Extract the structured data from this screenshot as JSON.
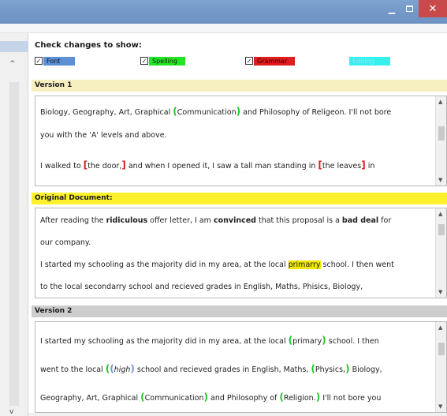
{
  "window": {
    "minimize_glyph": "▁",
    "close_glyph": "✕"
  },
  "check": {
    "title": "Check changes to show:",
    "checkmark": "✓",
    "font_label": "Font",
    "spelling_label": "Spelling",
    "grammar_label": "Grammar",
    "editing_label": "Editing"
  },
  "sections": {
    "version1": "Version 1",
    "original": "Original Document:",
    "version2": "Version 2"
  },
  "version1": {
    "l1_a": "Biology, Geography, Art, Graphical ",
    "l1_b": "Communication",
    "l1_c": " and Philosophy of Religeon. I'll not bore",
    "l2": "you with the 'A' levels and above.",
    "l3_a": "I walked to ",
    "l3_b": "the door,",
    "l3_c": " and when I opened it, I saw a tall man standing in ",
    "l3_d": "the leaves",
    "l3_e": " in"
  },
  "original": {
    "l1_a": "After reading the ",
    "l1_b": "ridiculous",
    "l1_c": " offer letter, I am ",
    "l1_d": "convinced",
    "l1_e": " that this proposal is a ",
    "l1_f": "bad deal",
    "l1_g": " for",
    "l2": "our company.",
    "l3_a": "I started my schooling as the majority did in my area, at the local ",
    "l3_b": "primarry",
    "l3_c": " school. I then went",
    "l4": "to the local secondarry school and recieved grades in English, Maths, Phisics, Biology,"
  },
  "version2": {
    "l1_a": "I started my schooling as the majority did in my area, at the local ",
    "l1_b": "primary",
    "l1_c": " school. I then",
    "l2_a": "went to the local ",
    "l2_b": "high",
    "l2_c": " school and recieved grades in English, Maths, ",
    "l2_d": "Physics,",
    "l2_e": " Biology,",
    "l3_a": "Geography, Art, Graphical ",
    "l3_b": "Communication",
    "l3_c": " and Philosophy of ",
    "l3_d": "Religion.",
    "l3_e": " I'll not bore you"
  },
  "colors": {
    "font": "#5b8fd6",
    "spelling": "#22e522",
    "grammar": "#e01c1c",
    "editing": "#36f0ee",
    "original_header": "#fcf12c"
  },
  "icons": {
    "up_arrow": "▲",
    "down_arrow": "▼",
    "left_up": "^",
    "left_down": "v"
  }
}
